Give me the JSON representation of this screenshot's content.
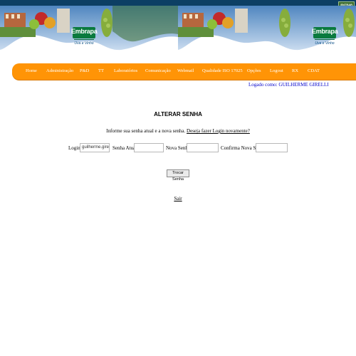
{
  "header": {
    "top_button": "ENTRAR",
    "logo_brand": "Embrapa",
    "logo_sub": "Uva e Vinho"
  },
  "nav": {
    "items": [
      "Home",
      "Administração",
      "P&D",
      "TT",
      "Laboratórios",
      "Comunicação",
      "Webmail",
      "Qualidade ISO 17025",
      "Opções",
      "Logout",
      "RX",
      "CDAT"
    ]
  },
  "session": {
    "logged_label": "Logado como:",
    "user": "GUILHERME GIRELLI"
  },
  "form": {
    "title": "ALTERAR SENHA",
    "info_text": "Informe sua senha atual e a nova senha.",
    "info_link": "Deseja fazer Login novamente?",
    "login_label": "Login:",
    "login_value": "guilherme.gire",
    "current_label": "Senha Atual:",
    "new_label": "Nova Senha:",
    "confirm_label": "Confirma Nova Senha:",
    "submit_label": "Trocar Senha",
    "exit_link": "Sair"
  },
  "colors": {
    "nav_bg": "#ff9406",
    "top_bar": "#0c3f64",
    "link_blue": "#0000cc"
  }
}
